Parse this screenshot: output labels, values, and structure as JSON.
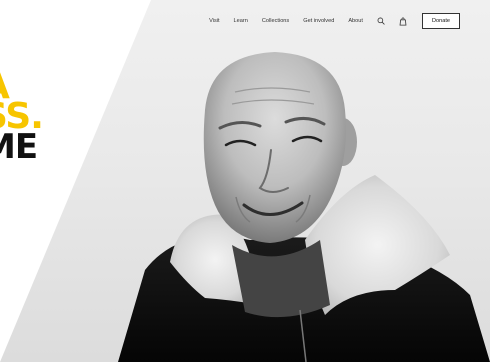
{
  "hero": {
    "lines": [
      "A",
      "SS.",
      "ME"
    ]
  },
  "nav": {
    "links": [
      "Visit",
      "Learn",
      "Collections",
      "Get involved",
      "About"
    ],
    "donate_label": "Donate",
    "icons": [
      "search-icon",
      "bag-icon"
    ]
  },
  "colors": {
    "accent": "#f7c500",
    "text_dark": "#111111",
    "background": "#ffffff"
  }
}
